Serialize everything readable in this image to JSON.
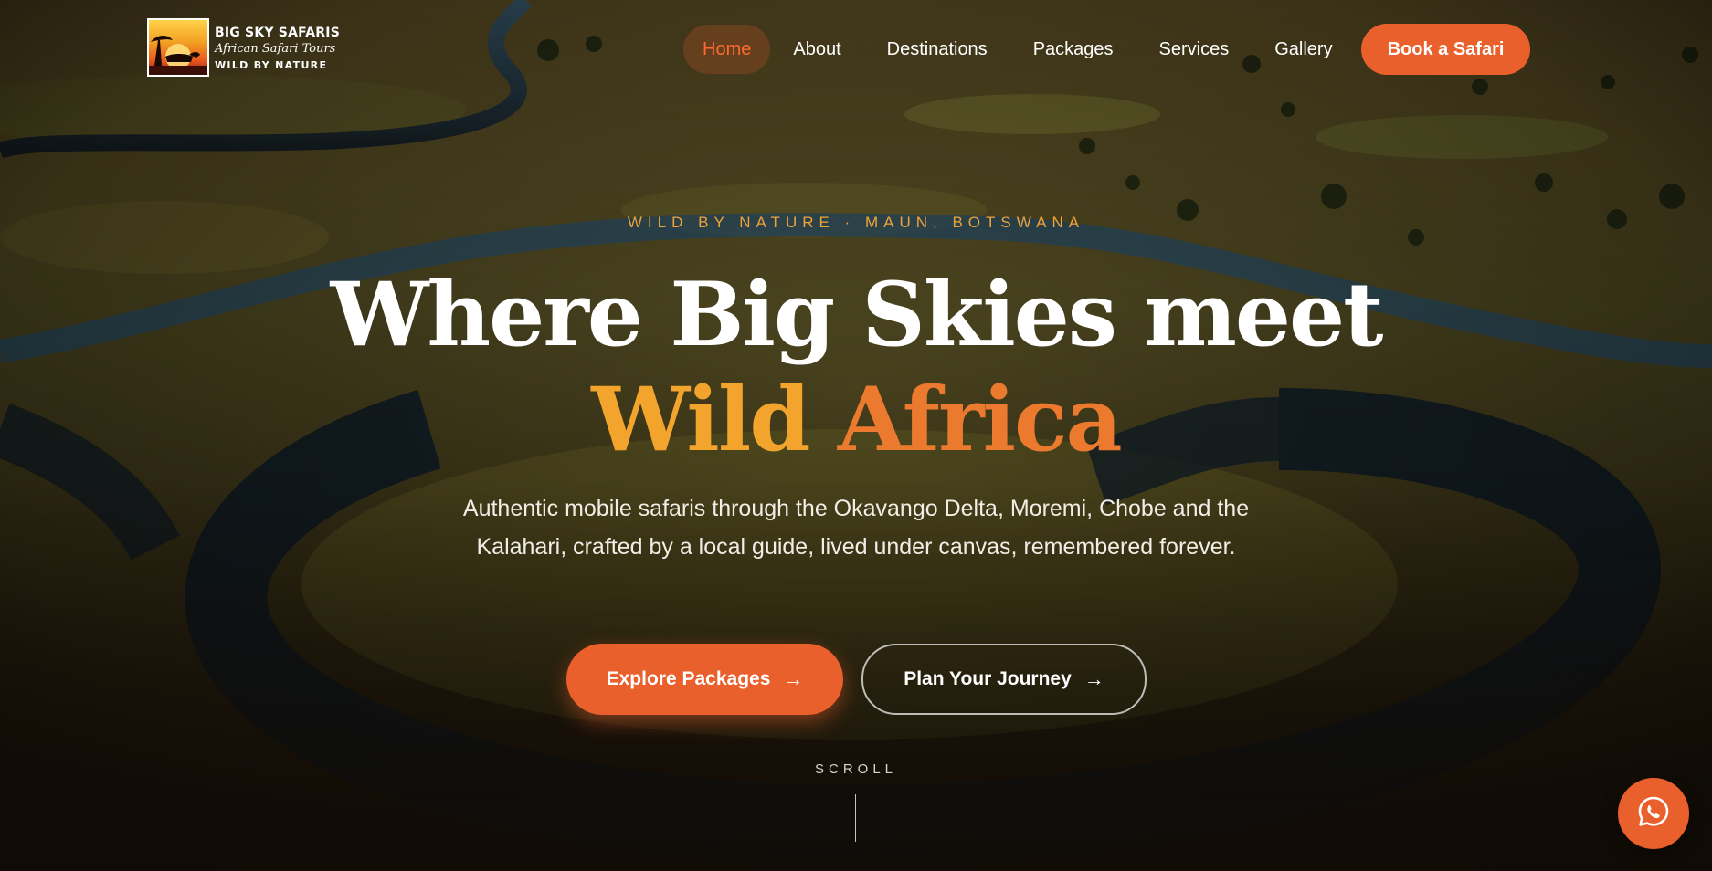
{
  "brand": {
    "title": "BIG SKY SAFARIS",
    "script": "African Safari Tours",
    "tagline": "WILD BY NATURE"
  },
  "nav": {
    "items": [
      {
        "label": "Home",
        "active": true
      },
      {
        "label": "About"
      },
      {
        "label": "Destinations"
      },
      {
        "label": "Packages"
      },
      {
        "label": "Services"
      },
      {
        "label": "Gallery"
      }
    ],
    "cta": "Book a Safari"
  },
  "hero": {
    "eyebrow": "WILD BY NATURE · MAUN, BOTSWANA",
    "heading_line1": "Where Big Skies meet",
    "heading_word1": "Wild",
    "heading_word2": "Africa",
    "lead": "Authentic mobile safaris through the Okavango Delta, Moremi, Chobe and the Kalahari, crafted by a local guide, lived under canvas, remembered forever.",
    "primary_cta": "Explore Packages",
    "secondary_cta": "Plan Your Journey",
    "arrow": "→",
    "scroll": "SCROLL"
  },
  "icons": {
    "whatsapp": "whatsapp-icon",
    "arrow": "arrow-right-icon"
  },
  "colors": {
    "accent": "#e9602c",
    "gold": "#f3a42c",
    "orange": "#ec7a2e"
  }
}
